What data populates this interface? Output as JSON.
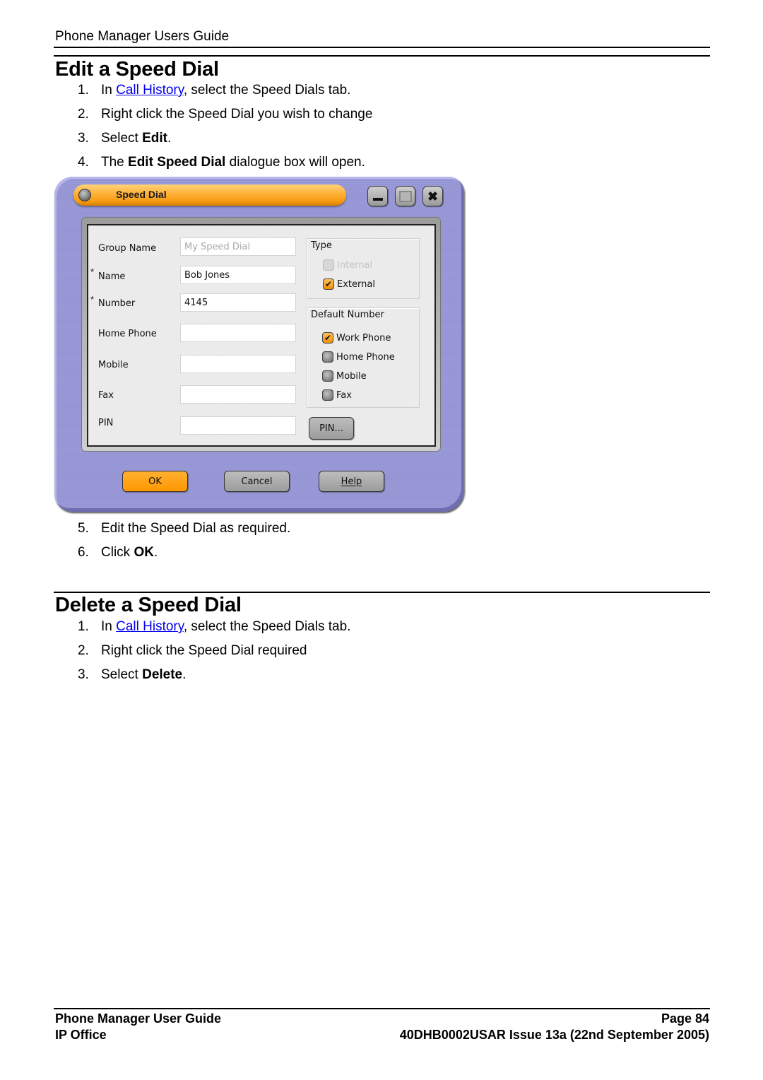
{
  "header": {
    "running_title": "Phone Manager Users Guide"
  },
  "section_edit": {
    "title": "Edit a Speed Dial",
    "steps_before": [
      {
        "num": "1.",
        "pre": "In ",
        "link": "Call History",
        "post": ", select the Speed Dials tab."
      },
      {
        "num": "2.",
        "text": "Right click the Speed Dial you wish to change"
      },
      {
        "num": "3.",
        "pre": "Select ",
        "bold": "Edit",
        "post": "."
      },
      {
        "num": "4.",
        "pre": "The ",
        "bold": "Edit Speed Dial",
        "post": " dialogue box will open."
      }
    ],
    "steps_after": [
      {
        "num": "5.",
        "text": "Edit the Speed Dial as required."
      },
      {
        "num": "6.",
        "pre": "Click ",
        "bold": "OK",
        "post": "."
      }
    ]
  },
  "dialog": {
    "title": "Speed Dial",
    "window_buttons": {
      "minimize": "minimize-icon",
      "maximize": "maximize-icon",
      "close": "close-icon"
    },
    "close_glyph": "✖",
    "required_marker": "*",
    "fields": {
      "group_name": {
        "label": "Group Name",
        "value": "My Speed Dial",
        "disabled": true
      },
      "name": {
        "label": "Name",
        "value": "Bob Jones",
        "required": true
      },
      "number": {
        "label": "Number",
        "value": "4145",
        "required": true
      },
      "home_phone": {
        "label": "Home Phone",
        "value": ""
      },
      "mobile": {
        "label": "Mobile",
        "value": ""
      },
      "fax": {
        "label": "Fax",
        "value": ""
      },
      "pin": {
        "label": "PIN",
        "value": ""
      }
    },
    "type_group": {
      "title": "Type",
      "options": [
        {
          "label": "Internal",
          "checked": false,
          "disabled": true
        },
        {
          "label": "External",
          "checked": true,
          "disabled": false
        }
      ]
    },
    "default_number_group": {
      "title": "Default Number",
      "options": [
        {
          "label": "Work Phone",
          "checked": true
        },
        {
          "label": "Home Phone",
          "checked": false
        },
        {
          "label": "Mobile",
          "checked": false
        },
        {
          "label": "Fax",
          "checked": false
        }
      ]
    },
    "check_glyph": "✔",
    "pin_button": "PIN...",
    "buttons": {
      "ok": "OK",
      "cancel": "Cancel",
      "help": "Help"
    },
    "colors": {
      "frame": "#9a9ad8",
      "titlebar": "#ffb036",
      "primary_button": "#ff9800"
    }
  },
  "section_delete": {
    "title": "Delete a Speed Dial",
    "steps": [
      {
        "num": "1.",
        "pre": "In ",
        "link": "Call History",
        "post": ", select the Speed Dials tab."
      },
      {
        "num": "2.",
        "text": "Right click the Speed Dial required"
      },
      {
        "num": "3.",
        "pre": "Select ",
        "bold": "Delete",
        "post": "."
      }
    ]
  },
  "footer": {
    "left_line1": "Phone Manager User Guide",
    "left_line2": "IP Office",
    "right_line1": "Page 84",
    "right_line2": "40DHB0002USAR Issue 13a (22nd September 2005)"
  }
}
